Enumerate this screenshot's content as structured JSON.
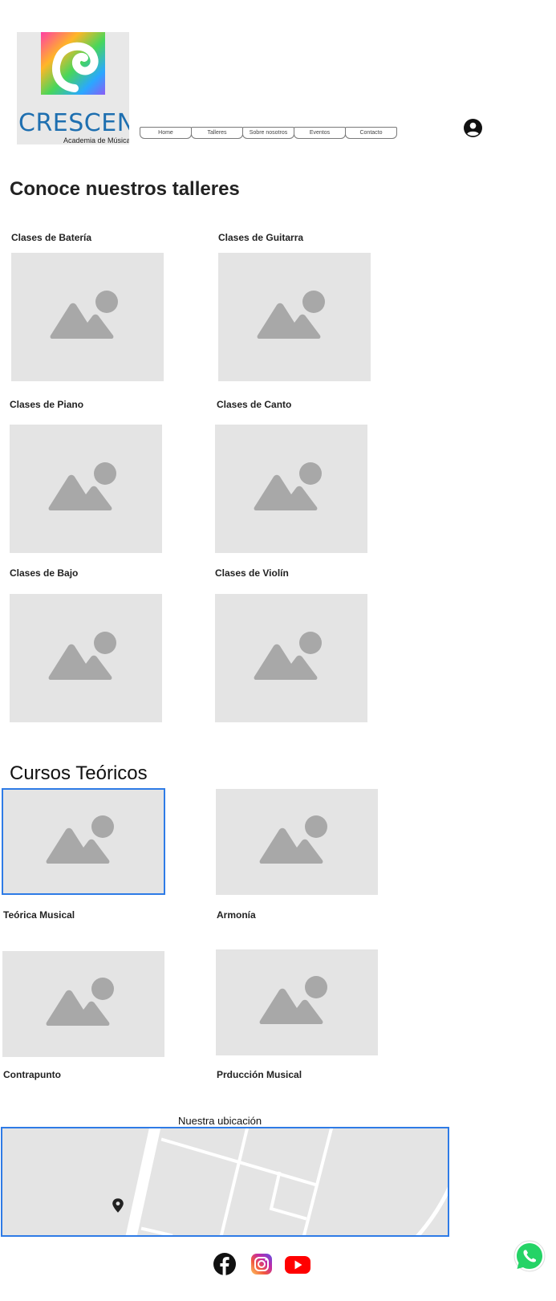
{
  "logo": {
    "brand": "CRESCENDO",
    "subtitle": "Academia de Música"
  },
  "nav": {
    "items": [
      "Home",
      "Talleres",
      "Sobre nosotros",
      "Eventos",
      "Contacto"
    ]
  },
  "icons": {
    "user": "user-circle-icon",
    "facebook": "facebook-icon",
    "instagram": "instagram-icon",
    "youtube": "youtube-icon",
    "whatsapp": "whatsapp-icon",
    "map_pin": "map-pin-icon",
    "placeholder": "image-placeholder-icon"
  },
  "talleres": {
    "title": "Conoce nuestros talleres",
    "items": [
      "Clases de Batería",
      "Clases de Guitarra",
      "Clases de Piano",
      "Clases de Canto",
      "Clases de Bajo",
      "Clases de Violín"
    ]
  },
  "cursos": {
    "title": "Cursos Teóricos",
    "items": [
      "Teórica Musical",
      "Armonía",
      "Contrapunto",
      "Prducción Musical"
    ]
  },
  "map": {
    "title": "Nuestra ubicación"
  },
  "colors": {
    "accent": "#2e7be6",
    "logo_blue": "#1e6fb0",
    "placeholder_bg": "#e4e4e4",
    "placeholder_fg": "#a8a8a8",
    "youtube": "#ff0000",
    "whatsapp": "#25d366"
  }
}
